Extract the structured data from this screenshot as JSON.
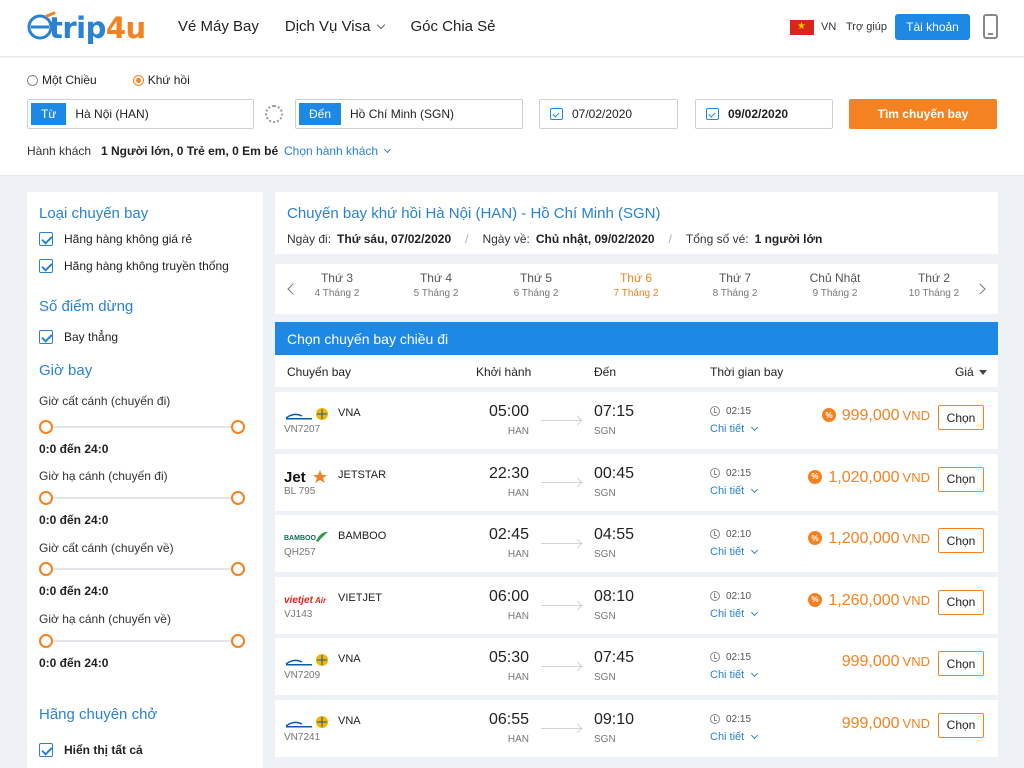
{
  "header": {
    "logo_trip": "trip",
    "logo_4u": "4u",
    "nav": [
      {
        "label": "Vé Máy Bay"
      },
      {
        "label": "Dịch Vụ Visa"
      },
      {
        "label": "Góc Chia Sẻ"
      }
    ],
    "lang": "VN",
    "help": "Trợ giúp",
    "account": "Tài khoản"
  },
  "search": {
    "one_way": "Một Chiều",
    "round_trip": "Khứ hồi",
    "from_tag": "Từ",
    "from_value": "Hà Nội (HAN)",
    "to_tag": "Đến",
    "to_value": "Hồ Chí Minh (SGN)",
    "depart_date": "07/02/2020",
    "return_date": "09/02/2020",
    "search_button": "Tìm chuyến bay",
    "pax_label": "Hành khách",
    "pax_value": "1 Người lớn, 0 Trẻ em, 0 Em bé",
    "pax_choose": "Chọn hành khách"
  },
  "sidebar": {
    "flight_type_title": "Loại chuyến bay",
    "flight_type_options": [
      "Hãng hàng không giá rẻ",
      "Hãng hàng không truyền thống"
    ],
    "stops_title": "Số điểm dừng",
    "stops_option": "Bay thẳng",
    "time_title": "Giờ bay",
    "sliders": [
      {
        "label": "Giờ cất cánh (chuyến đi)",
        "range": "0:0 đến 24:0"
      },
      {
        "label": "Giờ hạ cánh (chuyến đi)",
        "range": "0:0 đến 24:0"
      },
      {
        "label": "Giờ cất cánh (chuyến về)",
        "range": "0:0 đến 24:0"
      },
      {
        "label": "Giờ hạ cánh (chuyến về)",
        "range": "0:0 đến 24:0"
      }
    ],
    "airline_title": "Hãng chuyên chở",
    "airline_option": "Hiển thị tất cả"
  },
  "info": {
    "title": "Chuyến bay khứ hồi Hà Nội (HAN) - Hồ Chí Minh (SGN)",
    "depart_label": "Ngày đi:",
    "depart_value": "Thứ sáu, 07/02/2020",
    "return_label": "Ngày về:",
    "return_value": "Chủ nhật, 09/02/2020",
    "tickets_label": "Tổng số vé:",
    "tickets_value": "1 người lớn"
  },
  "days": [
    {
      "name": "Thứ 3",
      "date": "4 Tháng 2"
    },
    {
      "name": "Thứ 4",
      "date": "5 Tháng 2"
    },
    {
      "name": "Thứ 5",
      "date": "6 Tháng 2"
    },
    {
      "name": "Thứ 6",
      "date": "7 Tháng 2",
      "active": true
    },
    {
      "name": "Thứ 7",
      "date": "8 Tháng 2"
    },
    {
      "name": "Chủ Nhật",
      "date": "9 Tháng 2"
    },
    {
      "name": "Thứ 2",
      "date": "10 Tháng 2"
    }
  ],
  "results": {
    "bar_title": "Chọn chuyến bay chiều đi",
    "col_flight": "Chuyến bay",
    "col_depart": "Khởi hành",
    "col_arrive": "Đến",
    "col_duration": "Thời gian bay",
    "col_price": "Giá",
    "detail_label": "Chi tiết",
    "choose_label": "Chọn",
    "currency": "VND",
    "flights": [
      {
        "airline": "VNA",
        "logo": "vietnam-airlines",
        "flight_no": "VN7207",
        "dep": "05:00",
        "dep_air": "HAN",
        "arr": "07:15",
        "arr_air": "SGN",
        "duration": "02:15",
        "price": "999,000",
        "promo": true
      },
      {
        "airline": "JETSTAR",
        "logo": "jetstar",
        "flight_no": "BL 795",
        "dep": "22:30",
        "dep_air": "HAN",
        "arr": "00:45",
        "arr_air": "SGN",
        "duration": "02:15",
        "price": "1,020,000",
        "promo": true
      },
      {
        "airline": "BAMBOO",
        "logo": "bamboo",
        "flight_no": "QH257",
        "dep": "02:45",
        "dep_air": "HAN",
        "arr": "04:55",
        "arr_air": "SGN",
        "duration": "02:10",
        "price": "1,200,000",
        "promo": true
      },
      {
        "airline": "VIETJET",
        "logo": "vietjet",
        "flight_no": "VJ143",
        "dep": "06:00",
        "dep_air": "HAN",
        "arr": "08:10",
        "arr_air": "SGN",
        "duration": "02:10",
        "price": "1,260,000",
        "promo": true
      },
      {
        "airline": "VNA",
        "logo": "vietnam-airlines",
        "flight_no": "VN7209",
        "dep": "05:30",
        "dep_air": "HAN",
        "arr": "07:45",
        "arr_air": "SGN",
        "duration": "02:15",
        "price": "999,000",
        "promo": false
      },
      {
        "airline": "VNA",
        "logo": "vietnam-airlines",
        "flight_no": "VN7241",
        "dep": "06:55",
        "dep_air": "HAN",
        "arr": "09:10",
        "arr_air": "SGN",
        "duration": "02:15",
        "price": "999,000",
        "promo": false
      }
    ]
  },
  "colors": {
    "brand_blue": "#1e88e5",
    "accent_orange": "#f58220"
  }
}
